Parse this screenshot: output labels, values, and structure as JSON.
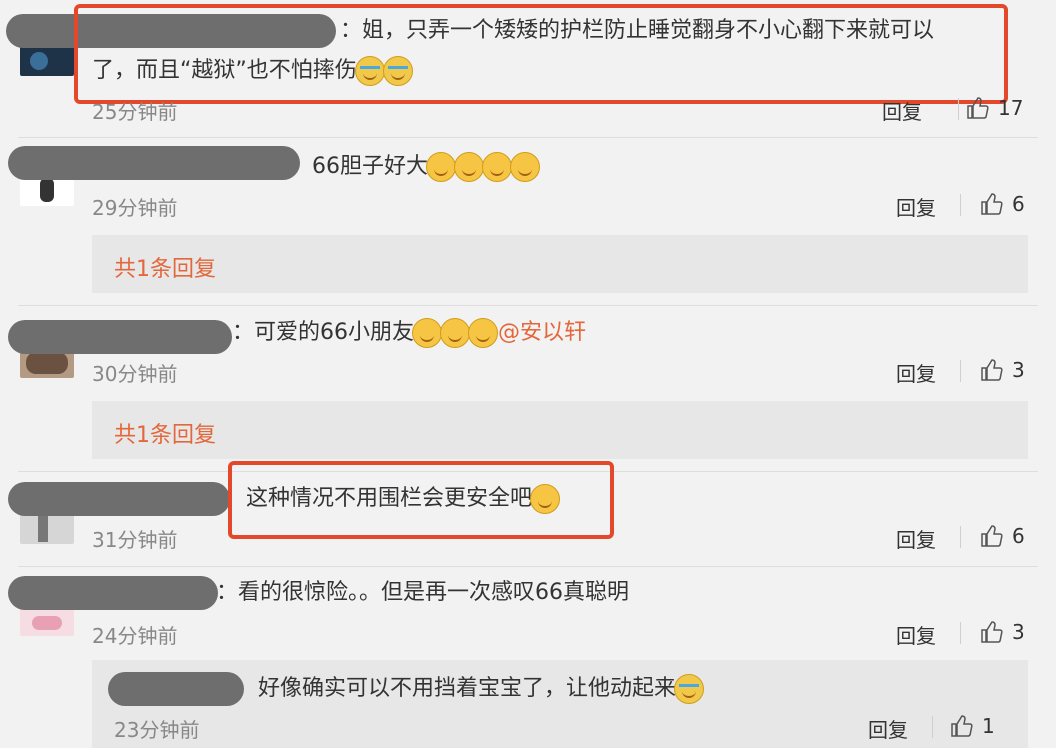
{
  "reply_label": "回复",
  "comments": [
    {
      "text": "姐，只弄一个矮矮的护栏防止睡觉翻身不小心翻下来就可以了，而且“越狱”也不怕摔伤",
      "line1": "：姐，只弄一个矮矮的护栏防止睡觉翻身不小心翻下来就可以",
      "line2": "了，而且“越狱”也不怕摔伤",
      "time": "25分钟前",
      "likes": "17"
    },
    {
      "text": "66胆子好大",
      "time": "29分钟前",
      "likes": "6",
      "replies_link": "共1条回复"
    },
    {
      "prefix": "：",
      "text": "可爱的66小朋友",
      "mention": "@安以轩",
      "time": "30分钟前",
      "likes": "3",
      "replies_link": "共1条回复"
    },
    {
      "text": "这种情况不用围栏会更安全吧",
      "time": "31分钟前",
      "likes": "6"
    },
    {
      "prefix": "：",
      "text": "看的很惊险。。但是再一次感叹66真聪明",
      "time": "24分钟前",
      "likes": "3"
    }
  ],
  "sub_reply": {
    "text": "好像确实可以不用挡着宝宝了，让他动起来",
    "time": "23分钟前",
    "likes": "1"
  },
  "colors": {
    "highlight": "#e3482b",
    "link": "#e3673b"
  }
}
